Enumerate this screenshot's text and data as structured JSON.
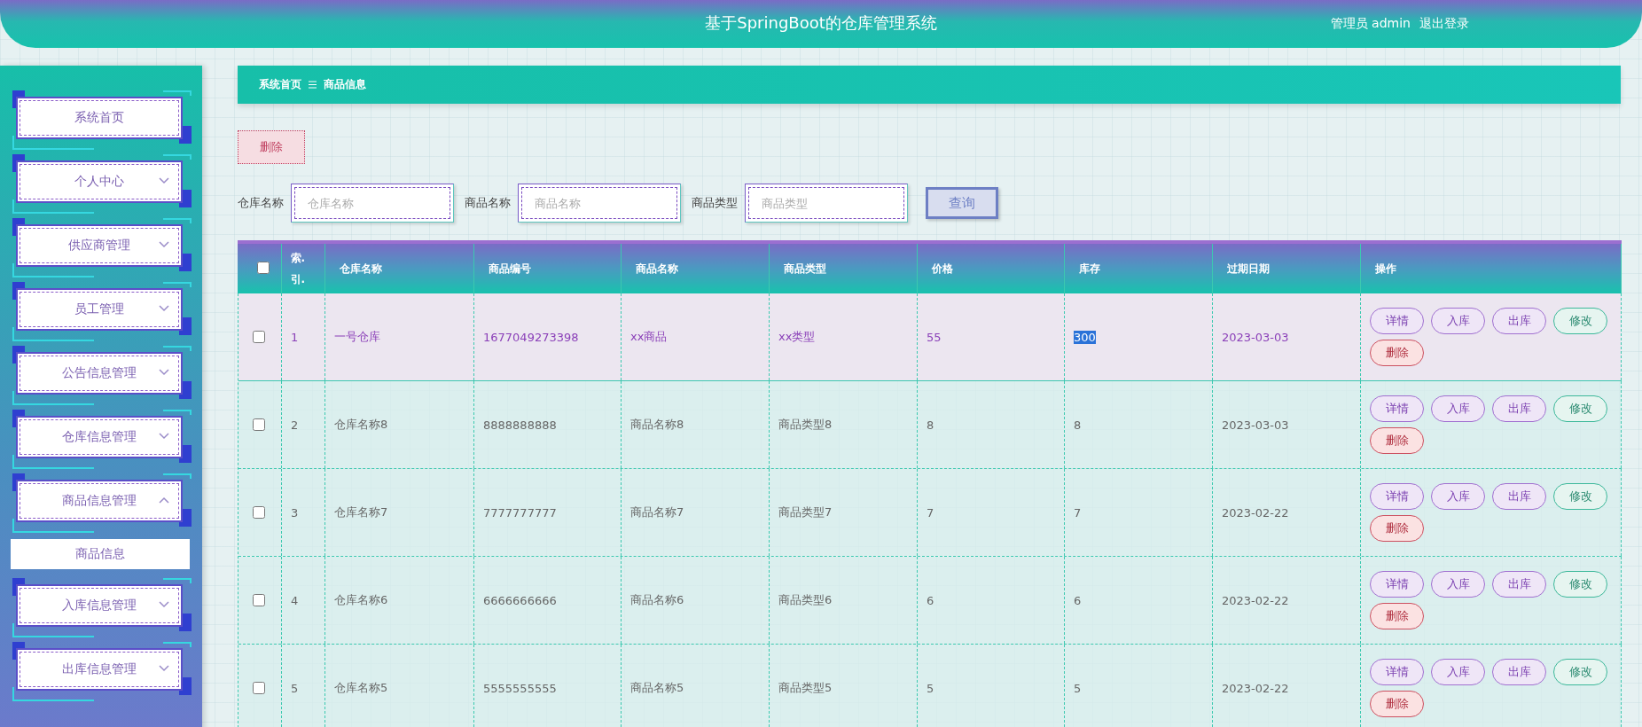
{
  "header": {
    "title": "基于SpringBoot的仓库管理系统",
    "user": "管理员 admin",
    "logout": "退出登录"
  },
  "sidebar": {
    "items": [
      {
        "label": "系统首页",
        "kind": "link"
      },
      {
        "label": "个人中心",
        "kind": "menu",
        "expanded": false
      },
      {
        "label": "供应商管理",
        "kind": "menu",
        "expanded": false
      },
      {
        "label": "员工管理",
        "kind": "menu",
        "expanded": false
      },
      {
        "label": "公告信息管理",
        "kind": "menu",
        "expanded": false
      },
      {
        "label": "仓库信息管理",
        "kind": "menu",
        "expanded": false
      },
      {
        "label": "商品信息管理",
        "kind": "menu",
        "expanded": true,
        "children": [
          {
            "label": "商品信息",
            "selected": true
          }
        ]
      },
      {
        "label": "入库信息管理",
        "kind": "menu",
        "expanded": false
      },
      {
        "label": "出库信息管理",
        "kind": "menu",
        "expanded": false
      }
    ]
  },
  "breadcrumb": [
    "系统首页",
    "商品信息"
  ],
  "delete_button": "删除",
  "search": {
    "fields": [
      {
        "label": "仓库名称",
        "placeholder": "仓库名称"
      },
      {
        "label": "商品名称",
        "placeholder": "商品名称"
      },
      {
        "label": "商品类型",
        "placeholder": "商品类型"
      }
    ],
    "button": "查询"
  },
  "table": {
    "select_all": {
      "checked": false
    },
    "columns": [
      "索.引.",
      "仓库名称",
      "商品编号",
      "商品名称",
      "商品类型",
      "价格",
      "库存",
      "过期日期",
      "操作"
    ],
    "rows": [
      {
        "index": "1",
        "warehouse": "一号仓库",
        "code": "1677049273398",
        "name": "xx商品",
        "type": "xx类型",
        "price": "55",
        "stock": "300",
        "stock_highlighted": true,
        "expiry": "2023-03-03",
        "selected": true,
        "checked": false,
        "actions": [
          {
            "label": "详情",
            "kind": "plain"
          },
          {
            "label": "入库",
            "kind": "plain"
          },
          {
            "label": "出库",
            "kind": "plain"
          },
          {
            "label": "修改",
            "kind": "edit"
          },
          {
            "label": "删除",
            "kind": "delete"
          }
        ]
      },
      {
        "index": "2",
        "warehouse": "仓库名称8",
        "code": "8888888888",
        "name": "商品名称8",
        "type": "商品类型8",
        "price": "8",
        "stock": "8",
        "stock_highlighted": false,
        "expiry": "2023-03-03",
        "selected": false,
        "checked": false,
        "actions": [
          {
            "label": "详情",
            "kind": "plain"
          },
          {
            "label": "入库",
            "kind": "plain"
          },
          {
            "label": "出库",
            "kind": "plain"
          },
          {
            "label": "修改",
            "kind": "edit"
          },
          {
            "label": "删除",
            "kind": "delete"
          }
        ]
      },
      {
        "index": "3",
        "warehouse": "仓库名称7",
        "code": "7777777777",
        "name": "商品名称7",
        "type": "商品类型7",
        "price": "7",
        "stock": "7",
        "stock_highlighted": false,
        "expiry": "2023-02-22",
        "selected": false,
        "checked": false,
        "actions": [
          {
            "label": "详情",
            "kind": "plain"
          },
          {
            "label": "入库",
            "kind": "plain"
          },
          {
            "label": "出库",
            "kind": "plain"
          },
          {
            "label": "修改",
            "kind": "edit"
          },
          {
            "label": "删除",
            "kind": "delete"
          }
        ]
      },
      {
        "index": "4",
        "warehouse": "仓库名称6",
        "code": "6666666666",
        "name": "商品名称6",
        "type": "商品类型6",
        "price": "6",
        "stock": "6",
        "stock_highlighted": false,
        "expiry": "2023-02-22",
        "selected": false,
        "checked": false,
        "actions": [
          {
            "label": "详情",
            "kind": "plain"
          },
          {
            "label": "入库",
            "kind": "plain"
          },
          {
            "label": "出库",
            "kind": "plain"
          },
          {
            "label": "修改",
            "kind": "edit"
          },
          {
            "label": "删除",
            "kind": "delete"
          }
        ]
      },
      {
        "index": "5",
        "warehouse": "仓库名称5",
        "code": "5555555555",
        "name": "商品名称5",
        "type": "商品类型5",
        "price": "5",
        "stock": "5",
        "stock_highlighted": false,
        "expiry": "2023-02-22",
        "selected": false,
        "checked": false,
        "actions": [
          {
            "label": "详情",
            "kind": "plain"
          },
          {
            "label": "入库",
            "kind": "plain"
          },
          {
            "label": "出库",
            "kind": "plain"
          },
          {
            "label": "修改",
            "kind": "edit"
          },
          {
            "label": "删除",
            "kind": "delete"
          }
        ]
      }
    ]
  }
}
